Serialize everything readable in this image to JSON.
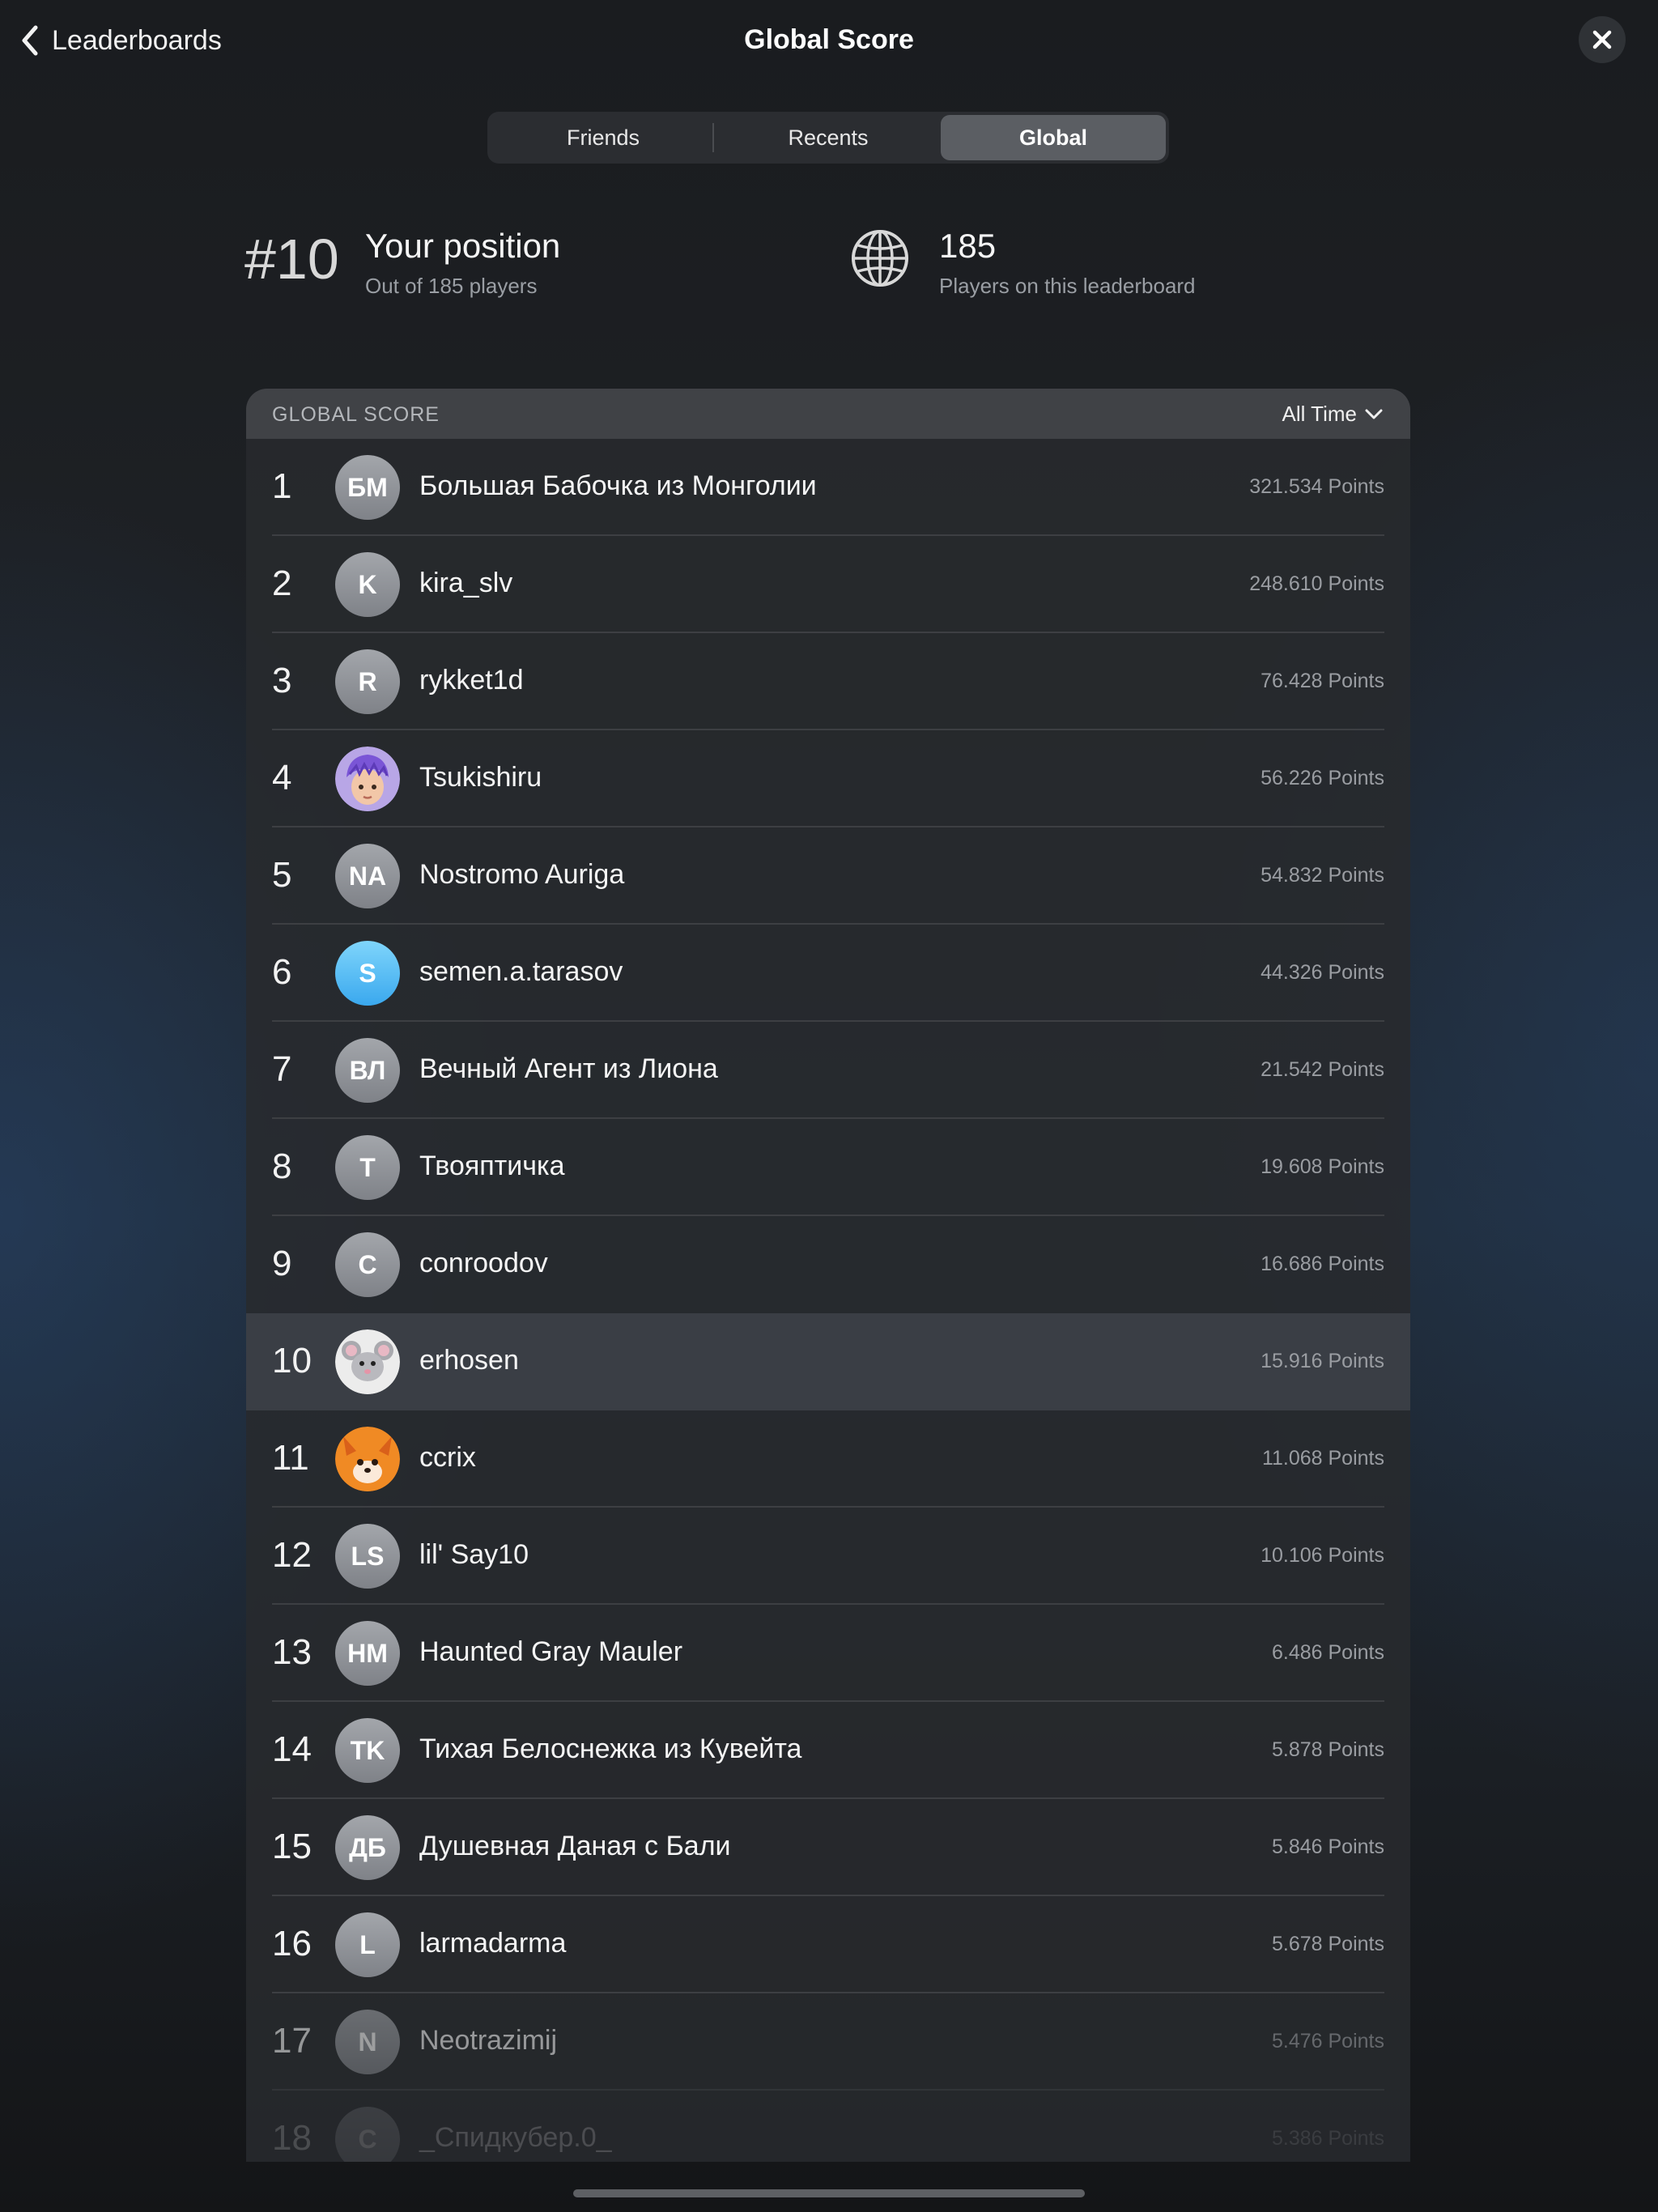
{
  "header": {
    "back_label": "Leaderboards",
    "title": "Global Score"
  },
  "tabs": [
    {
      "label": "Friends",
      "active": false
    },
    {
      "label": "Recents",
      "active": false
    },
    {
      "label": "Global",
      "active": true
    }
  ],
  "stats": {
    "rank": "#10",
    "position_title": "Your position",
    "position_sub": "Out of 185 players",
    "player_count": "185",
    "player_count_sub": "Players on this leaderboard"
  },
  "leaderboard": {
    "header_label": "GLOBAL SCORE",
    "time_filter": "All Time",
    "rows": [
      {
        "rank": "1",
        "initials": "БМ",
        "name": "Большая Бабочка из Монголии",
        "points": "321.534 Points"
      },
      {
        "rank": "2",
        "initials": "K",
        "name": "kira_slv",
        "points": "248.610 Points"
      },
      {
        "rank": "3",
        "initials": "R",
        "name": "rykket1d",
        "points": "76.428 Points"
      },
      {
        "rank": "4",
        "initials": "",
        "name": "Tsukishiru",
        "points": "56.226 Points"
      },
      {
        "rank": "5",
        "initials": "NA",
        "name": "Nostromo Auriga",
        "points": "54.832 Points"
      },
      {
        "rank": "6",
        "initials": "S",
        "name": "semen.a.tarasov",
        "points": "44.326 Points"
      },
      {
        "rank": "7",
        "initials": "ВЛ",
        "name": "Вечный Агент из Лиона",
        "points": "21.542 Points"
      },
      {
        "rank": "8",
        "initials": "T",
        "name": "Твояптичка",
        "points": "19.608 Points"
      },
      {
        "rank": "9",
        "initials": "C",
        "name": "conroodov",
        "points": "16.686 Points"
      },
      {
        "rank": "10",
        "initials": "",
        "name": "erhosen",
        "points": "15.916 Points"
      },
      {
        "rank": "11",
        "initials": "",
        "name": "ccrix",
        "points": "11.068 Points"
      },
      {
        "rank": "12",
        "initials": "LS",
        "name": "lil' Say10",
        "points": "10.106 Points"
      },
      {
        "rank": "13",
        "initials": "HM",
        "name": "Haunted Gray Mauler",
        "points": "6.486 Points"
      },
      {
        "rank": "14",
        "initials": "TK",
        "name": "Тихая Белоснежка из Кувейта",
        "points": "5.878 Points"
      },
      {
        "rank": "15",
        "initials": "ДБ",
        "name": "Душевная Даная с Бали",
        "points": "5.846 Points"
      },
      {
        "rank": "16",
        "initials": "L",
        "name": "larmadarma",
        "points": "5.678 Points"
      },
      {
        "rank": "17",
        "initials": "N",
        "name": "Neotrazimij",
        "points": "5.476 Points"
      },
      {
        "rank": "18",
        "initials": "C",
        "name": "_Спидкубер.0_",
        "points": "5.386 Points"
      }
    ]
  },
  "icons": {
    "back": "chevron-left-icon",
    "close": "close-icon",
    "globe": "globe-icon",
    "filter": "chevron-down-icon"
  }
}
